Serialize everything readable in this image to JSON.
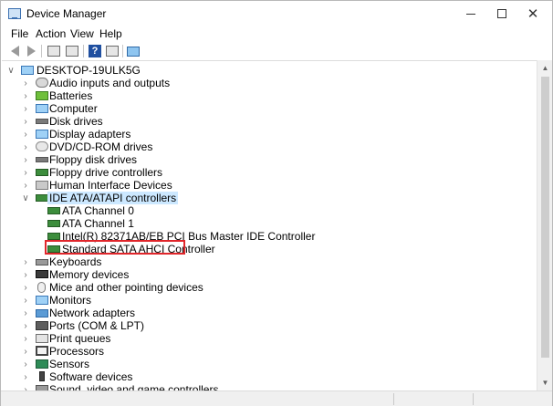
{
  "window": {
    "title": "Device Manager",
    "icon": "device-manager-icon",
    "controls": {
      "minimize": "—",
      "maximize": "□",
      "close": "✕"
    }
  },
  "menu": [
    "File",
    "Action",
    "View",
    "Help"
  ],
  "toolbar": [
    "back-icon",
    "forward-icon",
    "properties-panel-icon",
    "show-hidden-icon",
    "help-icon",
    "update-driver-icon",
    "scan-hardware-icon"
  ],
  "tree": {
    "root": "DESKTOP-19ULK5G",
    "categories": [
      {
        "label": "Audio inputs and outputs",
        "icon": "audio-icon"
      },
      {
        "label": "Batteries",
        "icon": "battery-icon"
      },
      {
        "label": "Computer",
        "icon": "computer-icon"
      },
      {
        "label": "Disk drives",
        "icon": "disk-drive-icon"
      },
      {
        "label": "Display adapters",
        "icon": "display-adapter-icon"
      },
      {
        "label": "DVD/CD-ROM drives",
        "icon": "dvd-drive-icon"
      },
      {
        "label": "Floppy disk drives",
        "icon": "floppy-disk-icon"
      },
      {
        "label": "Floppy drive controllers",
        "icon": "floppy-controller-icon"
      },
      {
        "label": "Human Interface Devices",
        "icon": "hid-icon"
      },
      {
        "label": "IDE ATA/ATAPI controllers",
        "icon": "ide-controller-icon",
        "expanded": true,
        "children": [
          "ATA Channel 0",
          "ATA Channel 1",
          "Intel(R) 82371AB/EB PCI Bus Master IDE Controller",
          "Standard SATA AHCI Controller"
        ]
      },
      {
        "label": "Keyboards",
        "icon": "keyboard-icon"
      },
      {
        "label": "Memory devices",
        "icon": "memory-icon"
      },
      {
        "label": "Mice and other pointing devices",
        "icon": "mouse-icon"
      },
      {
        "label": "Monitors",
        "icon": "monitor-icon"
      },
      {
        "label": "Network adapters",
        "icon": "network-adapter-icon"
      },
      {
        "label": "Ports (COM & LPT)",
        "icon": "ports-icon"
      },
      {
        "label": "Print queues",
        "icon": "printer-icon"
      },
      {
        "label": "Processors",
        "icon": "processor-icon"
      },
      {
        "label": "Sensors",
        "icon": "sensor-icon"
      },
      {
        "label": "Software devices",
        "icon": "software-device-icon"
      },
      {
        "label": "Sound, video and game controllers",
        "icon": "sound-icon"
      }
    ],
    "highlighted_child": "Standard SATA AHCI Controller"
  },
  "colors": {
    "highlight_border": "#e0262b",
    "selection_bg": "#cce8ff"
  }
}
